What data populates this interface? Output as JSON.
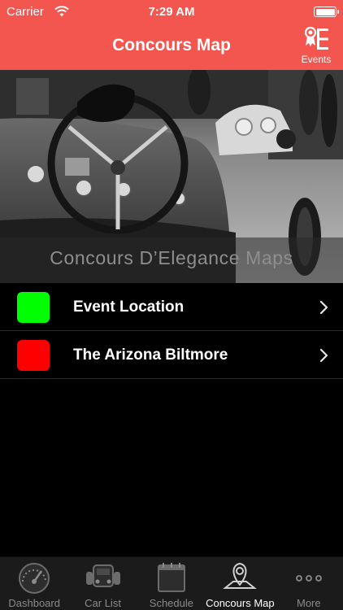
{
  "status_bar": {
    "carrier": "Carrier",
    "time": "7:29 AM"
  },
  "nav": {
    "title": "Concours Map",
    "events_label": "Events"
  },
  "hero": {
    "caption": "Concours D’Elegance Maps"
  },
  "map_list": [
    {
      "label": "Event Location",
      "color": "#00ff00"
    },
    {
      "label": "The Arizona Biltmore",
      "color": "#ff0000"
    }
  ],
  "tabs": [
    {
      "label": "Dashboard",
      "icon": "speedometer-icon",
      "active": false
    },
    {
      "label": "Car List",
      "icon": "car-icon",
      "active": false
    },
    {
      "label": "Schedule",
      "icon": "calendar-icon",
      "active": false
    },
    {
      "label": "Concours Map",
      "icon": "map-pin-icon",
      "active": true
    },
    {
      "label": "More",
      "icon": "more-icon",
      "active": false
    }
  ],
  "colors": {
    "accent": "#f2564f",
    "background": "#000000",
    "tab_bar": "#1b1b1b"
  }
}
